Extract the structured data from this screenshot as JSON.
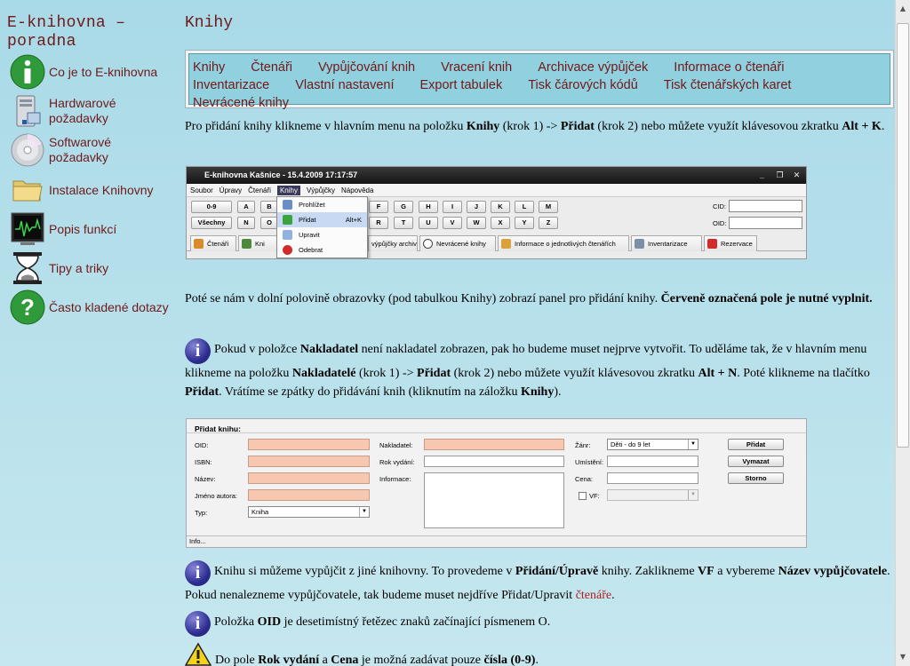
{
  "site": {
    "title": "E-knihovna – poradna"
  },
  "sidebar": {
    "items": [
      {
        "label": "Co je to E-knihovna",
        "icon": "info-icon"
      },
      {
        "label": "Hardwarové požadavky",
        "icon": "computer-icon"
      },
      {
        "label": "Softwarové požadavky",
        "icon": "cd-icon"
      },
      {
        "label": "Instalace Knihovny",
        "icon": "folder-icon"
      },
      {
        "label": "Popis funkcí",
        "icon": "monitor-icon"
      },
      {
        "label": "Tipy a triky",
        "icon": "hourglass-icon"
      },
      {
        "label": "Často kladené dotazy",
        "icon": "question-icon"
      }
    ]
  },
  "page": {
    "heading": "Knihy"
  },
  "topmenu": {
    "items": [
      "Knihy",
      "Čtenáři",
      "Vypůjčování knih",
      "Vracení knih",
      "Archivace výpůjček",
      "Informace o čtenáři",
      "Inventarizace",
      "Vlastní nastavení",
      "Export tabulek",
      "Tisk čárových kódů",
      "Tisk čtenářských karet",
      "Nevrácené knihy"
    ]
  },
  "content": {
    "p1": {
      "t1": "Pro přidání knihy klikneme v hlavním menu na položku ",
      "b1": "Knihy",
      "t2": " (krok 1) -> ",
      "b2": "Přidat",
      "t3": " (krok 2) nebo můžete využít klávesovou zkratku ",
      "b3": "Alt + K",
      "t4": "."
    },
    "p2": {
      "t1": "Poté se nám v dolní polovině obrazovky (pod tabulkou Knihy) zobrazí panel pro přidání knihy. ",
      "b1": "Červeně označená pole je nutné vyplnit."
    },
    "p3": {
      "t1": "Pokud v položce ",
      "b1": "Nakladatel",
      "t2": " není nakladatel zobrazen, pak ho budeme muset nejprve vytvořit. To uděláme tak, že v hlavním menu klikneme na položku ",
      "b2": "Nakladatelé",
      "t3": " (krok 1) -> ",
      "b3": "Přidat",
      "t4": " (krok 2) nebo můžete využít klávesovou zkratku ",
      "b4": "Alt + N",
      "t5": ". Poté klikneme na tlačítko ",
      "b5": "Přidat",
      "t6": ". Vrátíme se zpátky do přidávání knih (kliknutím na záložku ",
      "b6": "Knihy",
      "t7": ")."
    },
    "p4": {
      "t1": "Knihu si můžeme vypůjčit z jiné knihovny. To provedeme v ",
      "b1": "Přidání/Úpravě",
      "t2": " knihy. Zaklikneme ",
      "b2": "VF",
      "t3": " a vybereme ",
      "b3": "Název vypůjčovatele",
      "t4": ". Pokud nenalezneme vypůjčovatele, tak budeme muset nejdříve Přidat/Upravit ",
      "link": "čtenáře",
      "t5": "."
    },
    "p5": {
      "t1": "Položka ",
      "b1": "OID",
      "t2": " je desetimístný řetězec znaků začínající písmenem O."
    },
    "p6": {
      "t1": "Do pole ",
      "b1": "Rok vydání",
      "t2": " a ",
      "b2": "Cena",
      "t3": " je možná zadávat pouze ",
      "b3": "čísla (0-9)",
      "t4": "."
    }
  },
  "shot1": {
    "title": "E-knihovna Kašnice - 15.4.2009 17:17:57",
    "menus": [
      "Soubor",
      "Úpravy",
      "Čtenáři",
      "Knihy",
      "Výpůjčky",
      "Nápověda"
    ],
    "row1": [
      "0-9",
      "A",
      "B",
      "F",
      "G",
      "H",
      "I",
      "J",
      "K",
      "L",
      "M"
    ],
    "row2": [
      "Všechny",
      "N",
      "O",
      "R",
      "T",
      "U",
      "V",
      "W",
      "X",
      "Y",
      "Z"
    ],
    "cid_label": "CID:",
    "oid_label": "OID:",
    "tabs": [
      "Čtenáři",
      "Kni",
      "výpůjčky archiv",
      "Nevrácené knihy",
      "Informace o jednotlivých čtenářích",
      "Inventarizace",
      "Rezervace"
    ],
    "dropdown": [
      "Prohlížet",
      "Přidat",
      "Upravit",
      "Odebrat"
    ],
    "shortcut": "Alt+K"
  },
  "shot2": {
    "header": "Přidat knihu:",
    "labels_left": [
      "OID:",
      "ISBN:",
      "Název:",
      "Jméno autora:",
      "Typ:"
    ],
    "type_value": "Kniha",
    "labels_mid": [
      "Nakladatel:",
      "Rok vydání:",
      "Informace:"
    ],
    "labels_right": [
      "Žánr:",
      "Umístění:",
      "Cena:",
      "VF:"
    ],
    "genre_value": "Děti - do 9 let",
    "buttons": [
      "Přidat",
      "Vymazat",
      "Storno"
    ],
    "info": "Info..."
  },
  "colors": {
    "accent": "#6f1a1a",
    "required": "#f8c7b0",
    "menu_bg": "#91d0de"
  }
}
